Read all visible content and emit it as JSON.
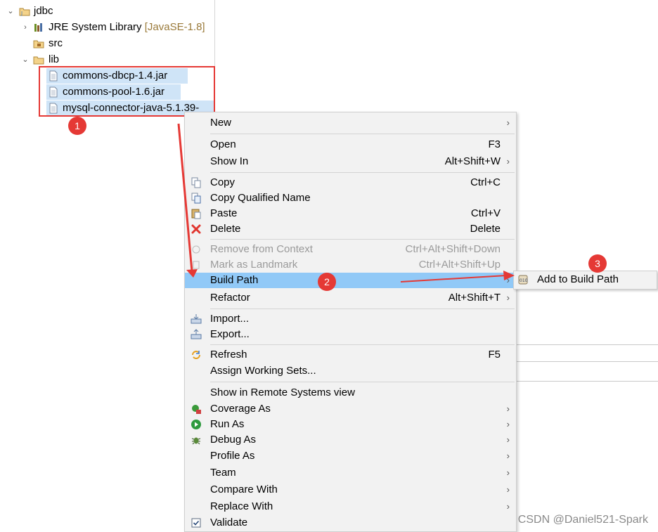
{
  "tree": {
    "project": "jdbc",
    "jre_label": "JRE System Library",
    "jre_decoration": "[JavaSE-1.8]",
    "src": "src",
    "lib": "lib",
    "jars": [
      "commons-dbcp-1.4.jar",
      "commons-pool-1.6.jar",
      "mysql-connector-java-5.1.39-"
    ]
  },
  "badges": {
    "one": "1",
    "two": "2",
    "three": "3"
  },
  "menu": {
    "new": "New",
    "open": "Open",
    "open_sc": "F3",
    "show_in": "Show In",
    "show_in_sc": "Alt+Shift+W",
    "copy": "Copy",
    "copy_sc": "Ctrl+C",
    "copy_qualified": "Copy Qualified Name",
    "paste": "Paste",
    "paste_sc": "Ctrl+V",
    "delete": "Delete",
    "delete_sc": "Delete",
    "remove_context": "Remove from Context",
    "remove_context_sc": "Ctrl+Alt+Shift+Down",
    "mark_landmark": "Mark as Landmark",
    "mark_landmark_sc": "Ctrl+Alt+Shift+Up",
    "build_path": "Build Path",
    "refactor": "Refactor",
    "refactor_sc": "Alt+Shift+T",
    "import": "Import...",
    "export": "Export...",
    "refresh": "Refresh",
    "refresh_sc": "F5",
    "assign_working_sets": "Assign Working Sets...",
    "show_remote": "Show in Remote Systems view",
    "coverage_as": "Coverage As",
    "run_as": "Run As",
    "debug_as": "Debug As",
    "profile_as": "Profile As",
    "team": "Team",
    "compare_with": "Compare With",
    "replace_with": "Replace With",
    "validate": "Validate",
    "chevron": "›"
  },
  "submenu": {
    "add_to_build_path": "Add to Build Path"
  },
  "watermark": "CSDN @Daniel521-Spark",
  "colors": {
    "highlight_red": "#e53935",
    "menu_active": "#91c9f7",
    "selection": "#cfe4f7"
  }
}
